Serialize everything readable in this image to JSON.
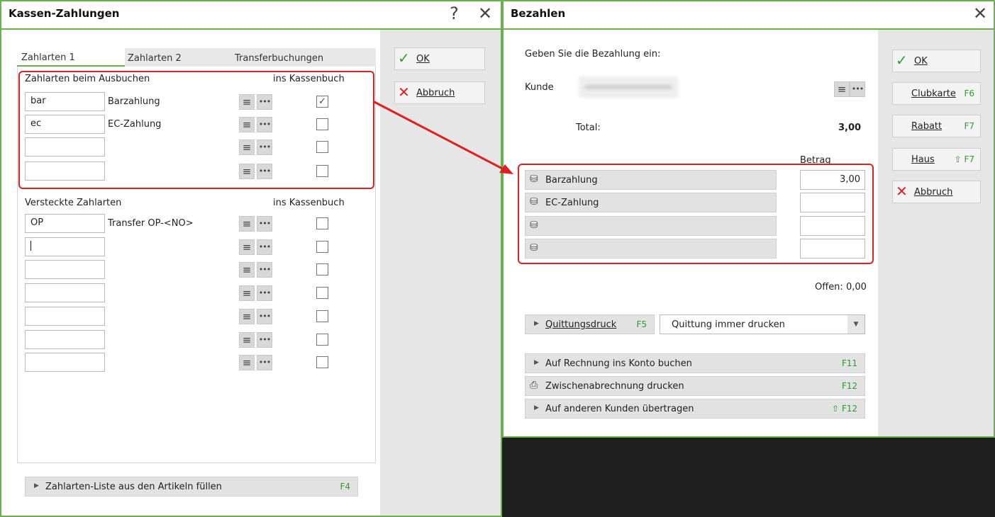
{
  "left_window": {
    "title": "Kassen-Zahlungen",
    "help_icon": "?",
    "close_icon": "✕",
    "tabs": [
      "Zahlarten 1",
      "Zahlarten 2",
      "Transferbuchungen"
    ],
    "section1": {
      "title": "Zahlarten beim Ausbuchen",
      "col_header": "ins Kassenbuch",
      "rows": [
        {
          "code": "bar",
          "name": "Barzahlung",
          "checked": true
        },
        {
          "code": "ec",
          "name": "EC-Zahlung",
          "checked": false
        },
        {
          "code": "",
          "name": "",
          "checked": false
        },
        {
          "code": "",
          "name": "",
          "checked": false
        }
      ]
    },
    "section2": {
      "title": "Versteckte Zahlarten",
      "col_header": "ins Kassenbuch",
      "rows": [
        {
          "code": "OP",
          "name": "Transfer OP-<NO>"
        },
        {
          "code": "",
          "name": ""
        },
        {
          "code": "",
          "name": ""
        },
        {
          "code": "",
          "name": ""
        },
        {
          "code": "",
          "name": ""
        },
        {
          "code": "",
          "name": ""
        },
        {
          "code": "",
          "name": ""
        }
      ]
    },
    "fill_button": {
      "label": "Zahlarten-Liste aus den Artikeln füllen",
      "key": "F4"
    },
    "ok_label": "OK",
    "cancel_label": "Abbruch"
  },
  "right_window": {
    "title": "Bezahlen",
    "close_icon": "✕",
    "prompt": "Geben Sie die Bezahlung ein:",
    "customer_label": "Kunde",
    "total_label": "Total:",
    "total_value": "3,00",
    "amount_header": "Betrag",
    "payments": [
      {
        "name": "Barzahlung",
        "amount": "3,00"
      },
      {
        "name": "EC-Zahlung",
        "amount": ""
      },
      {
        "name": "",
        "amount": ""
      },
      {
        "name": "",
        "amount": ""
      }
    ],
    "open_text": "Offen: 0,00",
    "receipt": {
      "label": "Quittungsdruck",
      "key": "F5",
      "option": "Quittung immer drucken"
    },
    "actions": [
      {
        "label": "Auf Rechnung ins Konto buchen",
        "key": "F11"
      },
      {
        "label": "Zwischenabrechnung drucken",
        "key": "F12"
      },
      {
        "label": "Auf anderen Kunden übertragen",
        "key": "⇧ F12"
      }
    ],
    "buttons": {
      "ok": "OK",
      "clubkarte": "Clubkarte",
      "clubkarte_key": "F6",
      "rabatt": "Rabatt",
      "rabatt_key": "F7",
      "haus": "Haus",
      "haus_key": "⇧ F7",
      "abbruch": "Abbruch"
    }
  }
}
